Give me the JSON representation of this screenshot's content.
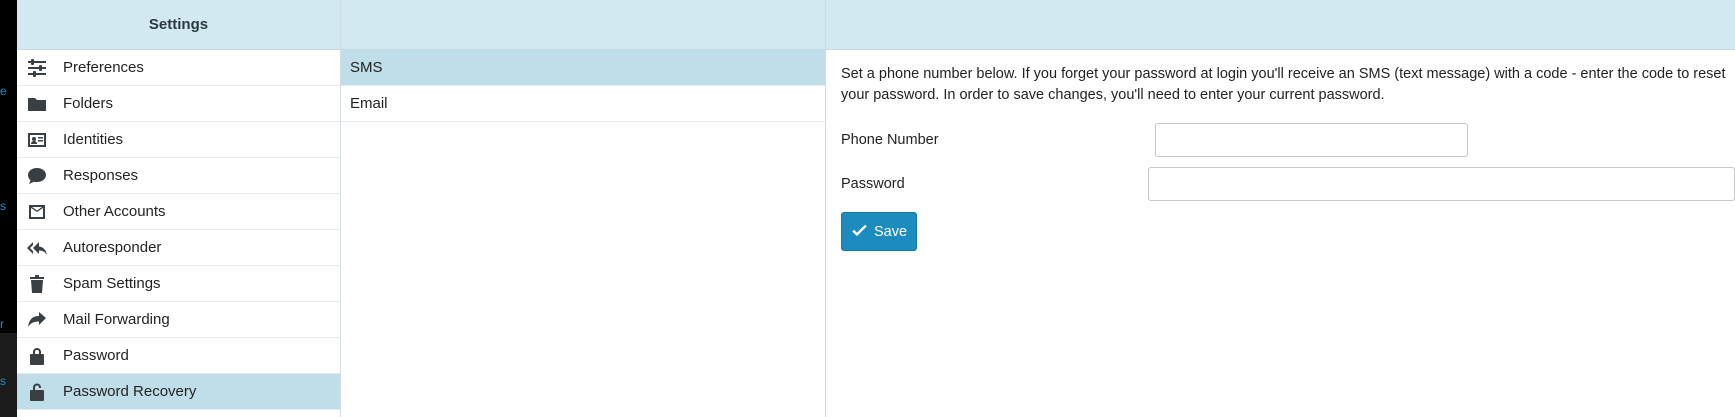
{
  "app_rail": {
    "marks": [
      "e",
      "s",
      "r",
      "s"
    ]
  },
  "settings_column": {
    "title": "Settings",
    "items": [
      {
        "label": "Preferences",
        "icon": "sliders-icon",
        "active": false
      },
      {
        "label": "Folders",
        "icon": "folder-icon",
        "active": false
      },
      {
        "label": "Identities",
        "icon": "id-card-icon",
        "active": false
      },
      {
        "label": "Responses",
        "icon": "comment-icon",
        "active": false
      },
      {
        "label": "Other Accounts",
        "icon": "envelope-icon",
        "active": false
      },
      {
        "label": "Autoresponder",
        "icon": "reply-all-icon",
        "active": false
      },
      {
        "label": "Spam Settings",
        "icon": "trash-icon",
        "active": false
      },
      {
        "label": "Mail Forwarding",
        "icon": "share-icon",
        "active": false
      },
      {
        "label": "Password",
        "icon": "lock-icon",
        "active": false
      },
      {
        "label": "Password Recovery",
        "icon": "unlock-icon",
        "active": true
      }
    ]
  },
  "sections_column": {
    "items": [
      {
        "label": "SMS",
        "active": true
      },
      {
        "label": "Email",
        "active": false
      }
    ]
  },
  "content": {
    "intro": "Set a phone number below. If you forget your password at login you'll receive an SMS (text message) with a code - enter the code to reset your password. In order to save changes, you'll need to enter your current password.",
    "phone_label": "Phone Number",
    "phone_value": "",
    "password_label": "Password",
    "password_value": "",
    "save_label": "Save",
    "save_icon": "check-icon"
  },
  "colors": {
    "header_bg": "#d2e9f1",
    "active_row_bg": "#c0deea",
    "primary_button": "#1c8bbd",
    "rail_accent": "#1d8fd1"
  }
}
